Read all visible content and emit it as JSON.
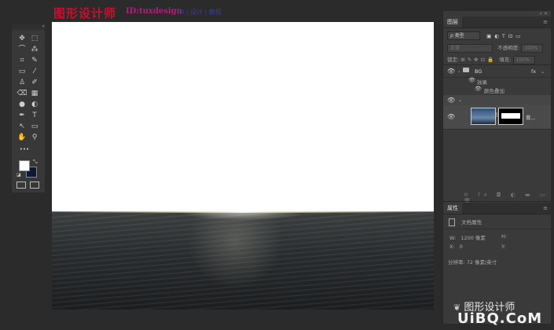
{
  "watermark": {
    "title": "图形设计师",
    "id": "ID:tuxdesign",
    "ui": "UI | 设计 | 教程"
  },
  "toolbox": {
    "header": "«",
    "tools": [
      "✥",
      "⬚",
      "⌒",
      "⁂",
      "⌗",
      "✎",
      "▭",
      "⁄",
      "♙",
      "✐",
      "⌫",
      "▦",
      "●",
      "◐",
      "✒",
      "T",
      "↖",
      "▭",
      "✋",
      "⚲",
      "•••"
    ]
  },
  "layers_panel": {
    "tab": "图层",
    "filter_label": "ρ 类型",
    "blend_mode": "正常",
    "opacity_label": "不透明度:",
    "opacity_value": "100%",
    "lock_label": "锁定:",
    "fill_label": "填充:",
    "fill_value": "100%",
    "layers": [
      {
        "name": "BG",
        "type": "group",
        "fx": "fx"
      },
      {
        "name": "效果",
        "type": "effects-header"
      },
      {
        "name": "颜色叠加",
        "type": "effect"
      },
      {
        "name": "",
        "type": "group-collapsed"
      },
      {
        "name": "背...",
        "type": "layer"
      }
    ],
    "footer_icons": "⊖ fx ◘ ◐ ▬ ▭ 🗑"
  },
  "properties_panel": {
    "tab": "属性",
    "section": "文档属性",
    "w_label": "W:",
    "w_value": "1200 像素",
    "h_label": "H:",
    "x_label": "X:",
    "x_value": "0",
    "y_label": "Y:",
    "resolution": "分辨率: 72 像素/英寸"
  },
  "corner_watermark": {
    "wechat": "图形设计师",
    "site": "UiBQ.CoM"
  },
  "colors": {
    "foreground": "#ffffff",
    "background": "#0d1a33",
    "accent_red": "#c8102e"
  }
}
